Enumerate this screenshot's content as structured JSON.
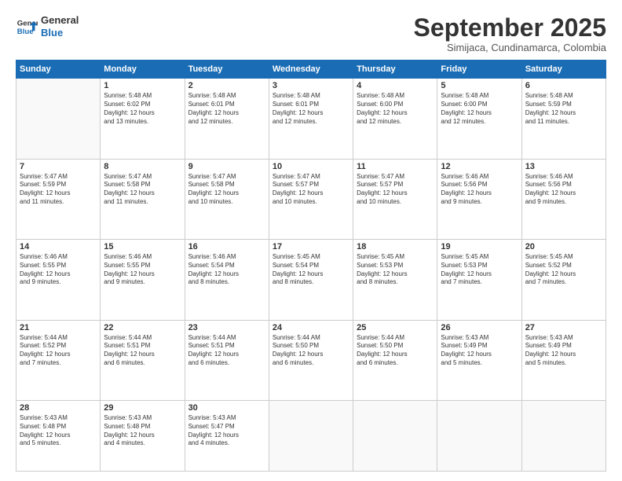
{
  "header": {
    "logo_line1": "General",
    "logo_line2": "Blue",
    "month": "September 2025",
    "location": "Simijaca, Cundinamarca, Colombia"
  },
  "weekdays": [
    "Sunday",
    "Monday",
    "Tuesday",
    "Wednesday",
    "Thursday",
    "Friday",
    "Saturday"
  ],
  "weeks": [
    [
      {
        "day": "",
        "text": ""
      },
      {
        "day": "1",
        "text": "Sunrise: 5:48 AM\nSunset: 6:02 PM\nDaylight: 12 hours\nand 13 minutes."
      },
      {
        "day": "2",
        "text": "Sunrise: 5:48 AM\nSunset: 6:01 PM\nDaylight: 12 hours\nand 12 minutes."
      },
      {
        "day": "3",
        "text": "Sunrise: 5:48 AM\nSunset: 6:01 PM\nDaylight: 12 hours\nand 12 minutes."
      },
      {
        "day": "4",
        "text": "Sunrise: 5:48 AM\nSunset: 6:00 PM\nDaylight: 12 hours\nand 12 minutes."
      },
      {
        "day": "5",
        "text": "Sunrise: 5:48 AM\nSunset: 6:00 PM\nDaylight: 12 hours\nand 12 minutes."
      },
      {
        "day": "6",
        "text": "Sunrise: 5:48 AM\nSunset: 5:59 PM\nDaylight: 12 hours\nand 11 minutes."
      }
    ],
    [
      {
        "day": "7",
        "text": "Sunrise: 5:47 AM\nSunset: 5:59 PM\nDaylight: 12 hours\nand 11 minutes."
      },
      {
        "day": "8",
        "text": "Sunrise: 5:47 AM\nSunset: 5:58 PM\nDaylight: 12 hours\nand 11 minutes."
      },
      {
        "day": "9",
        "text": "Sunrise: 5:47 AM\nSunset: 5:58 PM\nDaylight: 12 hours\nand 10 minutes."
      },
      {
        "day": "10",
        "text": "Sunrise: 5:47 AM\nSunset: 5:57 PM\nDaylight: 12 hours\nand 10 minutes."
      },
      {
        "day": "11",
        "text": "Sunrise: 5:47 AM\nSunset: 5:57 PM\nDaylight: 12 hours\nand 10 minutes."
      },
      {
        "day": "12",
        "text": "Sunrise: 5:46 AM\nSunset: 5:56 PM\nDaylight: 12 hours\nand 9 minutes."
      },
      {
        "day": "13",
        "text": "Sunrise: 5:46 AM\nSunset: 5:56 PM\nDaylight: 12 hours\nand 9 minutes."
      }
    ],
    [
      {
        "day": "14",
        "text": "Sunrise: 5:46 AM\nSunset: 5:55 PM\nDaylight: 12 hours\nand 9 minutes."
      },
      {
        "day": "15",
        "text": "Sunrise: 5:46 AM\nSunset: 5:55 PM\nDaylight: 12 hours\nand 9 minutes."
      },
      {
        "day": "16",
        "text": "Sunrise: 5:46 AM\nSunset: 5:54 PM\nDaylight: 12 hours\nand 8 minutes."
      },
      {
        "day": "17",
        "text": "Sunrise: 5:45 AM\nSunset: 5:54 PM\nDaylight: 12 hours\nand 8 minutes."
      },
      {
        "day": "18",
        "text": "Sunrise: 5:45 AM\nSunset: 5:53 PM\nDaylight: 12 hours\nand 8 minutes."
      },
      {
        "day": "19",
        "text": "Sunrise: 5:45 AM\nSunset: 5:53 PM\nDaylight: 12 hours\nand 7 minutes."
      },
      {
        "day": "20",
        "text": "Sunrise: 5:45 AM\nSunset: 5:52 PM\nDaylight: 12 hours\nand 7 minutes."
      }
    ],
    [
      {
        "day": "21",
        "text": "Sunrise: 5:44 AM\nSunset: 5:52 PM\nDaylight: 12 hours\nand 7 minutes."
      },
      {
        "day": "22",
        "text": "Sunrise: 5:44 AM\nSunset: 5:51 PM\nDaylight: 12 hours\nand 6 minutes."
      },
      {
        "day": "23",
        "text": "Sunrise: 5:44 AM\nSunset: 5:51 PM\nDaylight: 12 hours\nand 6 minutes."
      },
      {
        "day": "24",
        "text": "Sunrise: 5:44 AM\nSunset: 5:50 PM\nDaylight: 12 hours\nand 6 minutes."
      },
      {
        "day": "25",
        "text": "Sunrise: 5:44 AM\nSunset: 5:50 PM\nDaylight: 12 hours\nand 6 minutes."
      },
      {
        "day": "26",
        "text": "Sunrise: 5:43 AM\nSunset: 5:49 PM\nDaylight: 12 hours\nand 5 minutes."
      },
      {
        "day": "27",
        "text": "Sunrise: 5:43 AM\nSunset: 5:49 PM\nDaylight: 12 hours\nand 5 minutes."
      }
    ],
    [
      {
        "day": "28",
        "text": "Sunrise: 5:43 AM\nSunset: 5:48 PM\nDaylight: 12 hours\nand 5 minutes."
      },
      {
        "day": "29",
        "text": "Sunrise: 5:43 AM\nSunset: 5:48 PM\nDaylight: 12 hours\nand 4 minutes."
      },
      {
        "day": "30",
        "text": "Sunrise: 5:43 AM\nSunset: 5:47 PM\nDaylight: 12 hours\nand 4 minutes."
      },
      {
        "day": "",
        "text": ""
      },
      {
        "day": "",
        "text": ""
      },
      {
        "day": "",
        "text": ""
      },
      {
        "day": "",
        "text": ""
      }
    ]
  ]
}
